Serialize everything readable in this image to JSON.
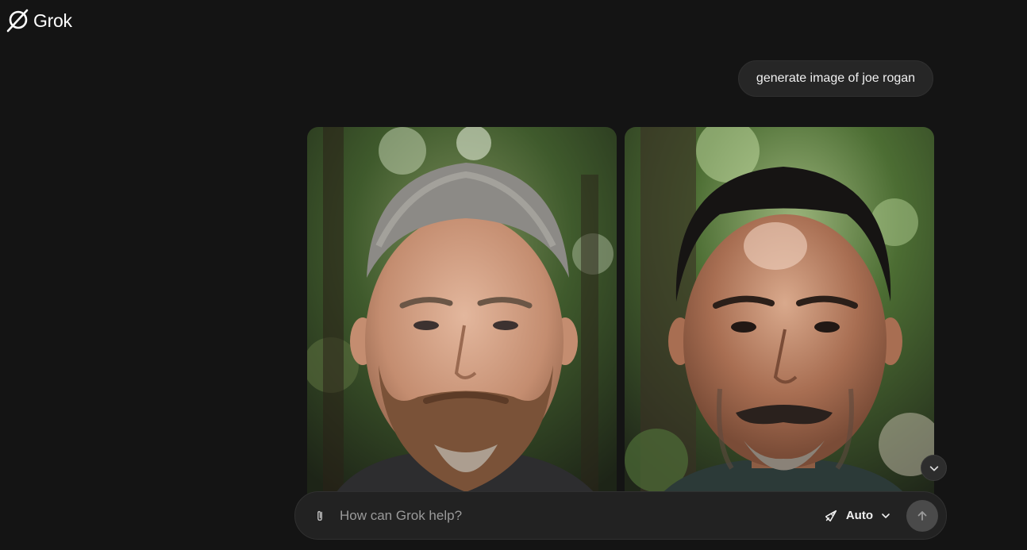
{
  "app": {
    "name": "Grok"
  },
  "conversation": {
    "user_message": "generate image of joe rogan",
    "images": [
      {
        "icon": "generated-portrait-gray-haired-bearded-man"
      },
      {
        "icon": "generated-portrait-dark-haired-goateed-man"
      }
    ]
  },
  "composer": {
    "placeholder": "How can Grok help?",
    "value": "",
    "mode_label": "Auto",
    "icons": {
      "attach": "paperclip-icon",
      "mode": "rocket-icon",
      "dropdown": "chevron-down-icon",
      "send": "arrow-up-icon"
    }
  },
  "colors": {
    "background": "#141414",
    "bubble": "#262626",
    "composer": "#222222",
    "send_button": "#4a4a4a"
  }
}
